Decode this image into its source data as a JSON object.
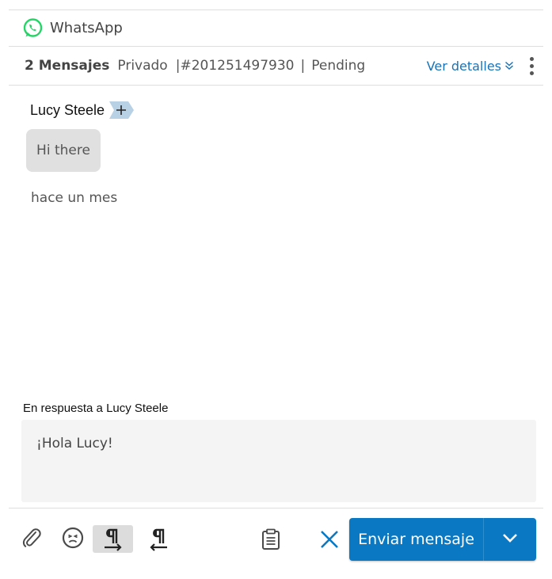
{
  "channel": {
    "name": "WhatsApp",
    "icon": "whatsapp-icon",
    "brand_color": "#25d366"
  },
  "conversation": {
    "message_count": "2 Mensajes",
    "type": "Privado",
    "id": "|#201251497930",
    "separator": "|",
    "status": "Pending",
    "details_link": "Ver detalles",
    "link_color": "#1a73b8"
  },
  "message": {
    "sender": "Lucy Steele",
    "text": "Hi there",
    "time": "hace un mes"
  },
  "reply": {
    "label": "En respuesta a Lucy Steele",
    "text": "¡Hola Lucy!"
  },
  "toolbar": {
    "send_label": "Enviar mensaje",
    "accent": "#0a78c2",
    "icons": [
      "paperclip-icon",
      "emoji-icon",
      "text-direction-ltr-icon",
      "text-direction-rtl-icon",
      "clipboard-template-icon",
      "close-icon",
      "chevron-down-icon"
    ]
  }
}
